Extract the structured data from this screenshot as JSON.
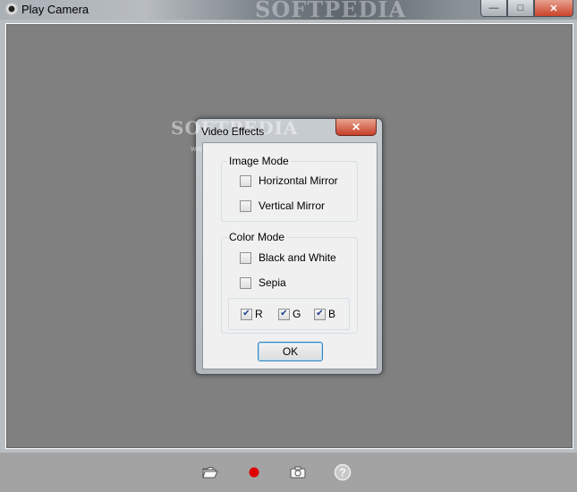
{
  "window": {
    "title": "Play Camera",
    "watermark": "SOFTPEDIA",
    "minimize": "—",
    "maximize": "□",
    "close": "✕"
  },
  "dialog": {
    "title": "Video Effects",
    "watermark": "SOFTPEDIA",
    "watermark_url": "www.softpedia.com",
    "close": "✕",
    "image_mode": {
      "label": "Image Mode",
      "horizontal_mirror": "Horizontal Mirror",
      "vertical_mirror": "Vertical Mirror"
    },
    "color_mode": {
      "label": "Color Mode",
      "black_and_white": "Black and White",
      "sepia": "Sepia",
      "r": "R",
      "g": "G",
      "b": "B"
    },
    "ok": "OK"
  },
  "checks": {
    "horizontal_mirror": false,
    "vertical_mirror": false,
    "black_and_white": false,
    "sepia": false,
    "r": true,
    "g": true,
    "b": true
  },
  "toolbar": {
    "icons": [
      "folder-open-icon",
      "record-icon",
      "camera-icon",
      "help-icon"
    ],
    "help_glyph": "?"
  },
  "colors": {
    "record": "#e00000",
    "video_bg": "#808080",
    "toolbar_bg": "#a3a3a3"
  }
}
